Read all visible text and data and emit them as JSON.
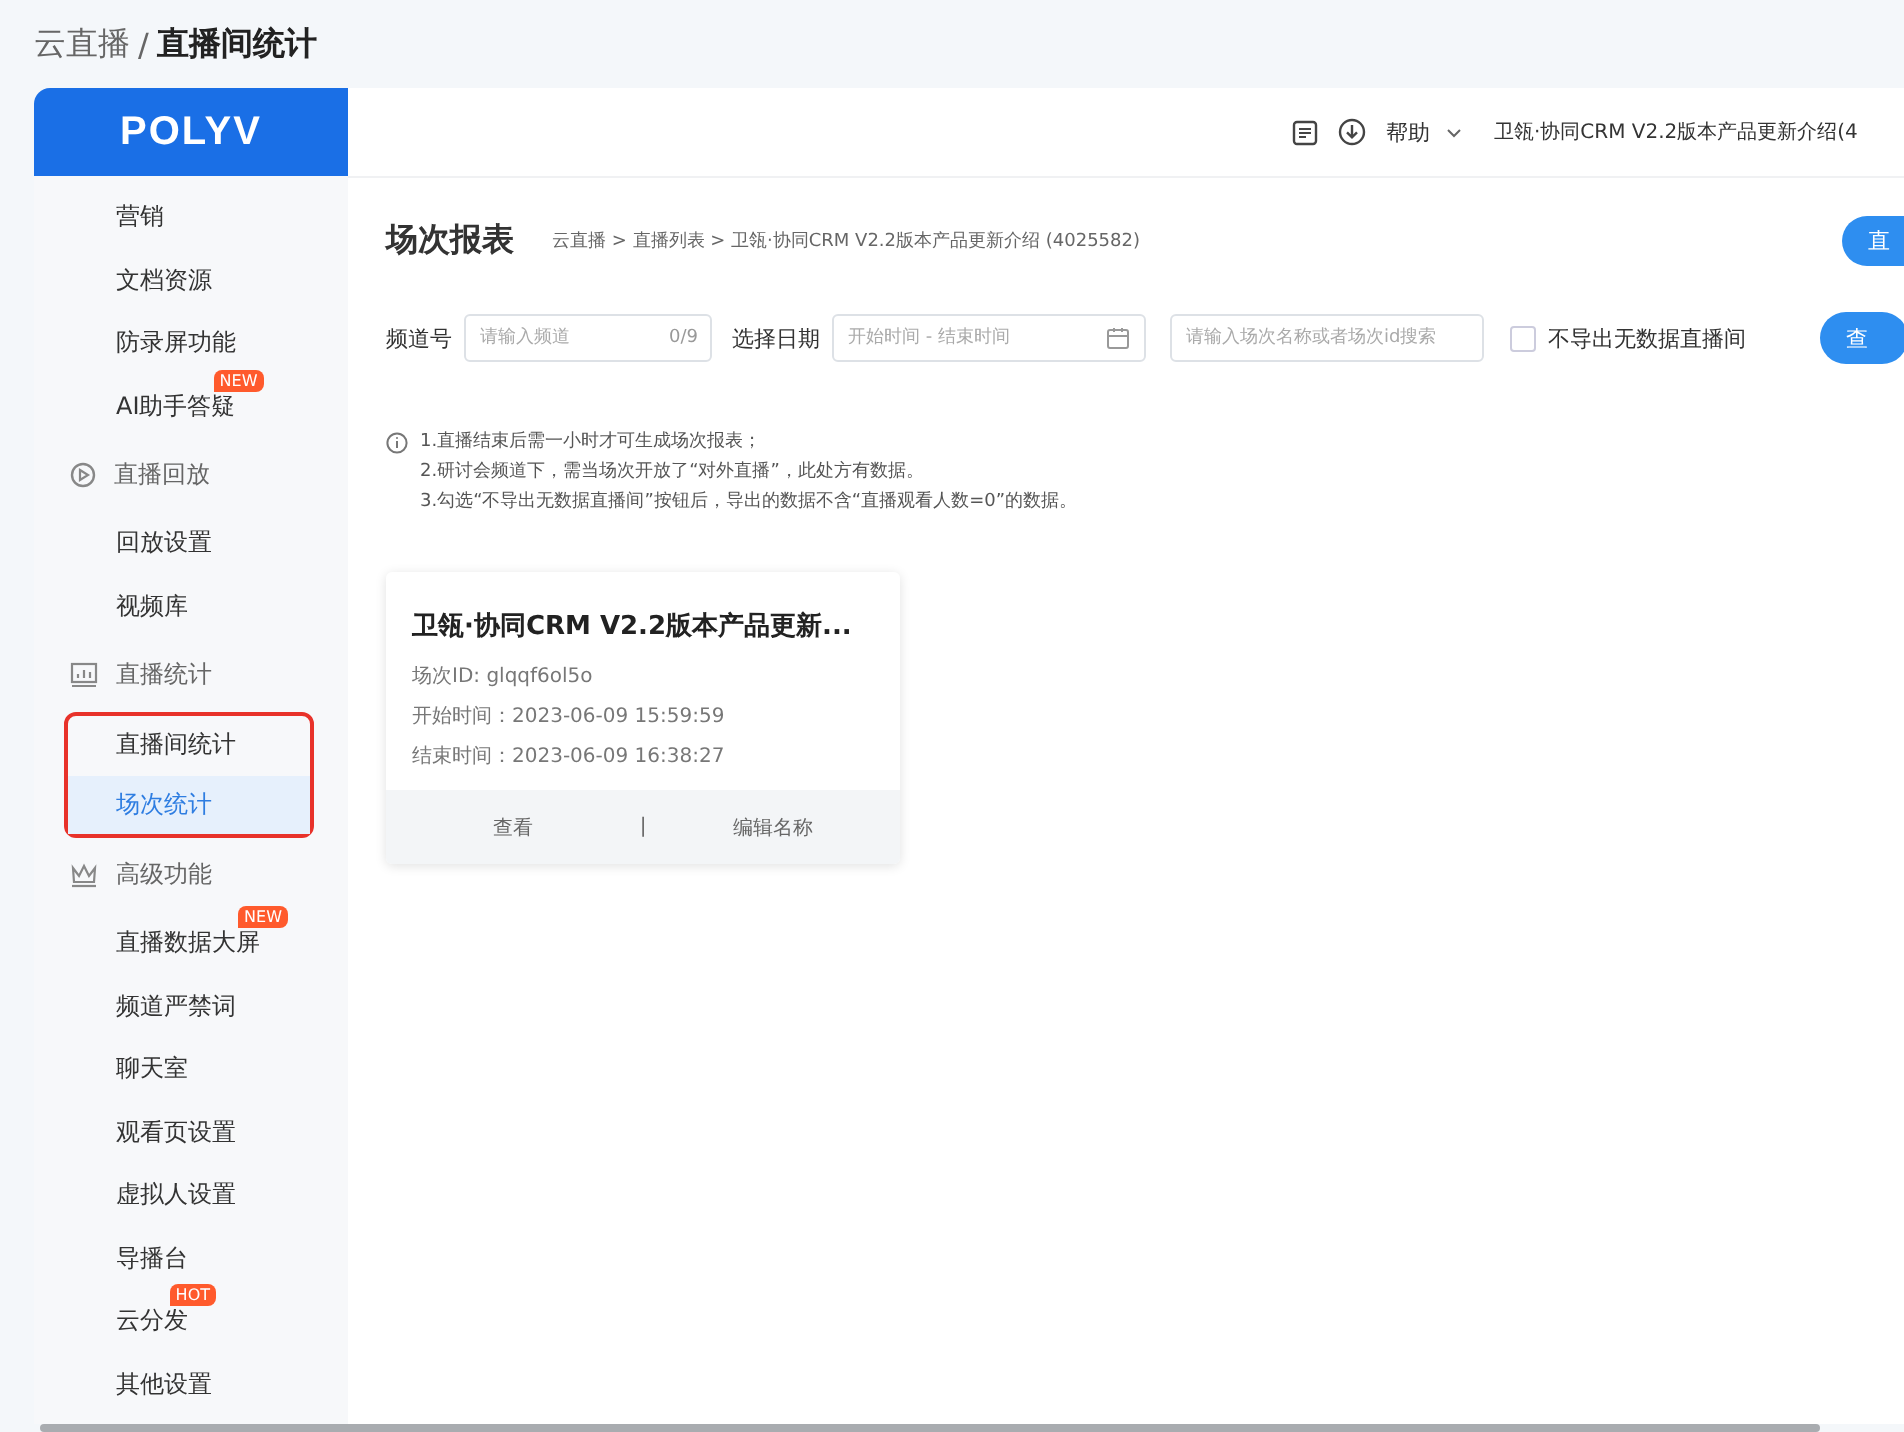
{
  "page_title": {
    "parent": "云直播",
    "separator": "/",
    "current": "直播间统计"
  },
  "logo": "POLYV",
  "topbar": {
    "help": "帮助",
    "channel": "卫瓴·协同CRM V2.2版本产品更新介绍(4"
  },
  "sidebar": {
    "sections": [
      {
        "kind": "plain",
        "items": [
          {
            "label": "营销",
            "selected": false,
            "highlighted": false
          },
          {
            "label": "文档资源",
            "selected": false,
            "highlighted": false
          },
          {
            "label": "防录屏功能",
            "selected": false,
            "highlighted": false
          },
          {
            "label": "AI助手答疑",
            "selected": false,
            "highlighted": false,
            "badge": "NEW"
          }
        ]
      },
      {
        "kind": "group",
        "title": "直播回放",
        "items": [
          {
            "label": "回放设置",
            "selected": false,
            "highlighted": false
          },
          {
            "label": "视频库",
            "selected": false,
            "highlighted": false
          }
        ]
      },
      {
        "kind": "group",
        "title": "直播统计",
        "items": [
          {
            "label": "直播间统计",
            "selected": false,
            "highlighted": true
          },
          {
            "label": "场次统计",
            "selected": true,
            "highlighted": true
          }
        ]
      },
      {
        "kind": "group",
        "title": "高级功能",
        "items": [
          {
            "label": "直播数据大屏",
            "selected": false,
            "highlighted": false,
            "badge": "NEW"
          },
          {
            "label": "频道严禁词",
            "selected": false,
            "highlighted": false
          },
          {
            "label": "聊天室",
            "selected": false,
            "highlighted": false
          },
          {
            "label": "观看页设置",
            "selected": false,
            "highlighted": false
          },
          {
            "label": "虚拟人设置",
            "selected": false,
            "highlighted": false
          },
          {
            "label": "导播台",
            "selected": false,
            "highlighted": false
          },
          {
            "label": "云分发",
            "selected": false,
            "highlighted": false,
            "badge": "HOT"
          },
          {
            "label": "其他设置",
            "selected": false,
            "highlighted": false
          }
        ]
      }
    ]
  },
  "content": {
    "title": "场次报表",
    "breadcrumb": "云直播 > 直播列表 > 卫瓴·协同CRM V2.2版本产品更新介绍 (4025582)",
    "top_button": "直",
    "filters": {
      "channel_label": "频道号",
      "channel_placeholder": "请输入频道",
      "channel_count": "0/9",
      "date_label": "选择日期",
      "date_placeholder": "开始时间 - 结束时间",
      "search_placeholder": "请输入场次名称或者场次id搜索",
      "checkbox": {
        "label": "不导出无数据直播间",
        "checked": false
      },
      "query_button": "查"
    },
    "notes": [
      "1.直播结束后需一小时才可生成场次报表；",
      "2.研讨会频道下，需当场次开放了“对外直播”，此处方有数据。",
      "3.勾选“不导出无数据直播间”按钮后，导出的数据不含“直播观看人数=0”的数据。"
    ],
    "cards": [
      {
        "title": "卫瓴·协同CRM V2.2版本产品更新...",
        "id_line": "场次ID: glqqf6ol5o",
        "start": "开始时间：2023-06-09 15:59:59",
        "end": "结束时间：2023-06-09 16:38:27",
        "view": "查看",
        "divider": "|",
        "rename": "编辑名称"
      }
    ]
  }
}
